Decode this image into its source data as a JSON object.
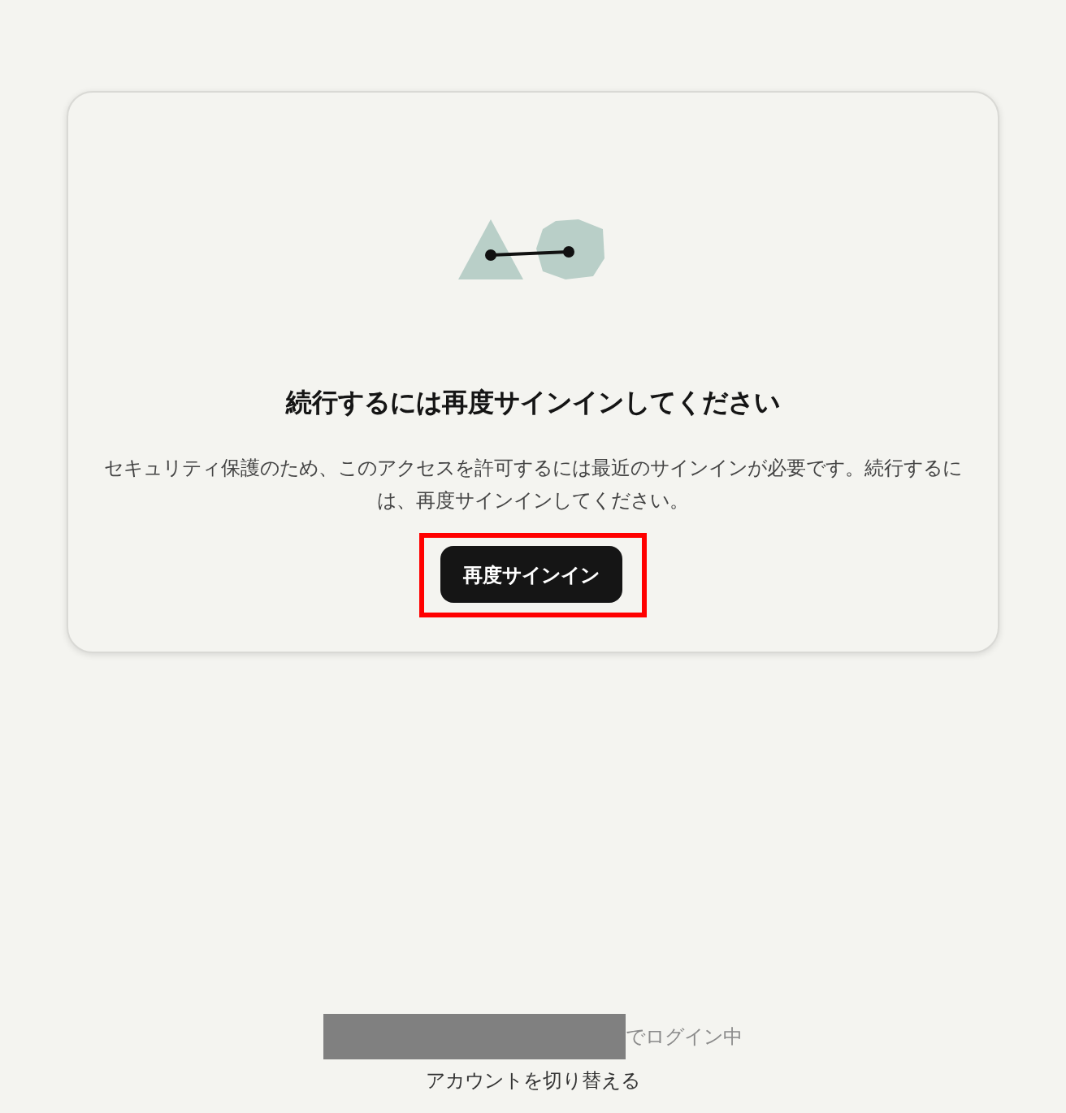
{
  "card": {
    "title": "続行するには再度サインインしてください",
    "message": "セキュリティ保護のため、このアクセスを許可するには最近のサインインが必要です。続行するには、再度サインインしてください。",
    "button": {
      "label": "再度サインイン",
      "highlighted": true
    }
  },
  "footer": {
    "account_redacted": true,
    "status": "でログイン中",
    "switch_account_link": "アカウントを切り替える"
  }
}
